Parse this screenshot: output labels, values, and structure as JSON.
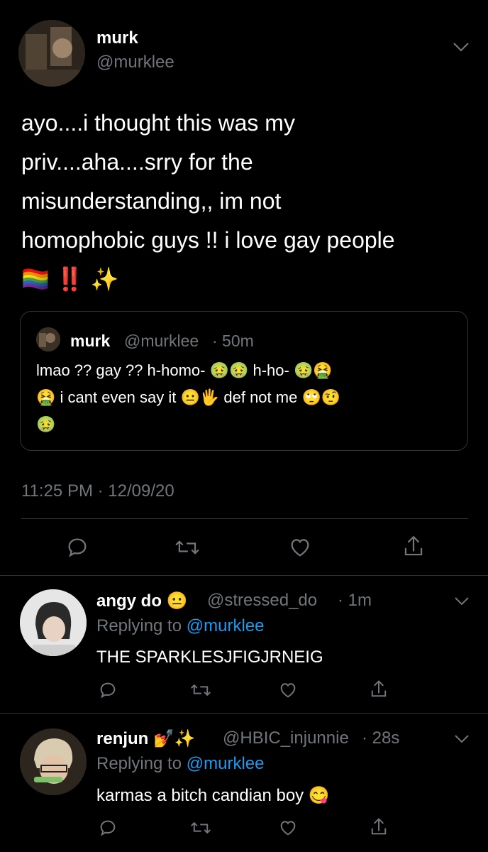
{
  "main_tweet": {
    "display_name": "murk",
    "handle": "@murklee",
    "text_lines": [
      "ayo....i thought this was my",
      "priv....aha....srry for the",
      "misunderstanding,, im not",
      "homophobic guys !! i love gay people"
    ],
    "emoji_line": "🏳️‍🌈 ‼️ ✨",
    "timestamp": "11:25 PM · 12/09/20"
  },
  "quoted_tweet": {
    "display_name": "murk",
    "handle": "@murklee",
    "time": "· 50m",
    "line1": "lmao ?? gay ?? h-homo- 🤢🤢 h-ho- 🤢🤮",
    "line2": "🤮 i cant even say it 😐🖐 def not me 🙄🤨",
    "line3": "🤢"
  },
  "replies": [
    {
      "display_name": "angy do 😐",
      "handle": "@stressed_do",
      "time": "· 1m",
      "replying_prefix": "Replying to",
      "replying_handle": "@murklee",
      "text": "THE SPARKLESJFIGJRNEIG"
    },
    {
      "display_name": "renjun 💅✨",
      "handle": "@HBIC_injunnie",
      "time": "· 28s",
      "replying_prefix": "Replying to",
      "replying_handle": "@murklee",
      "text": "karmas a bitch candian boy 😋"
    }
  ],
  "colors": {
    "background": "#000000",
    "muted": "#71767b",
    "link": "#1d9bf0",
    "divider": "#2f3336"
  }
}
